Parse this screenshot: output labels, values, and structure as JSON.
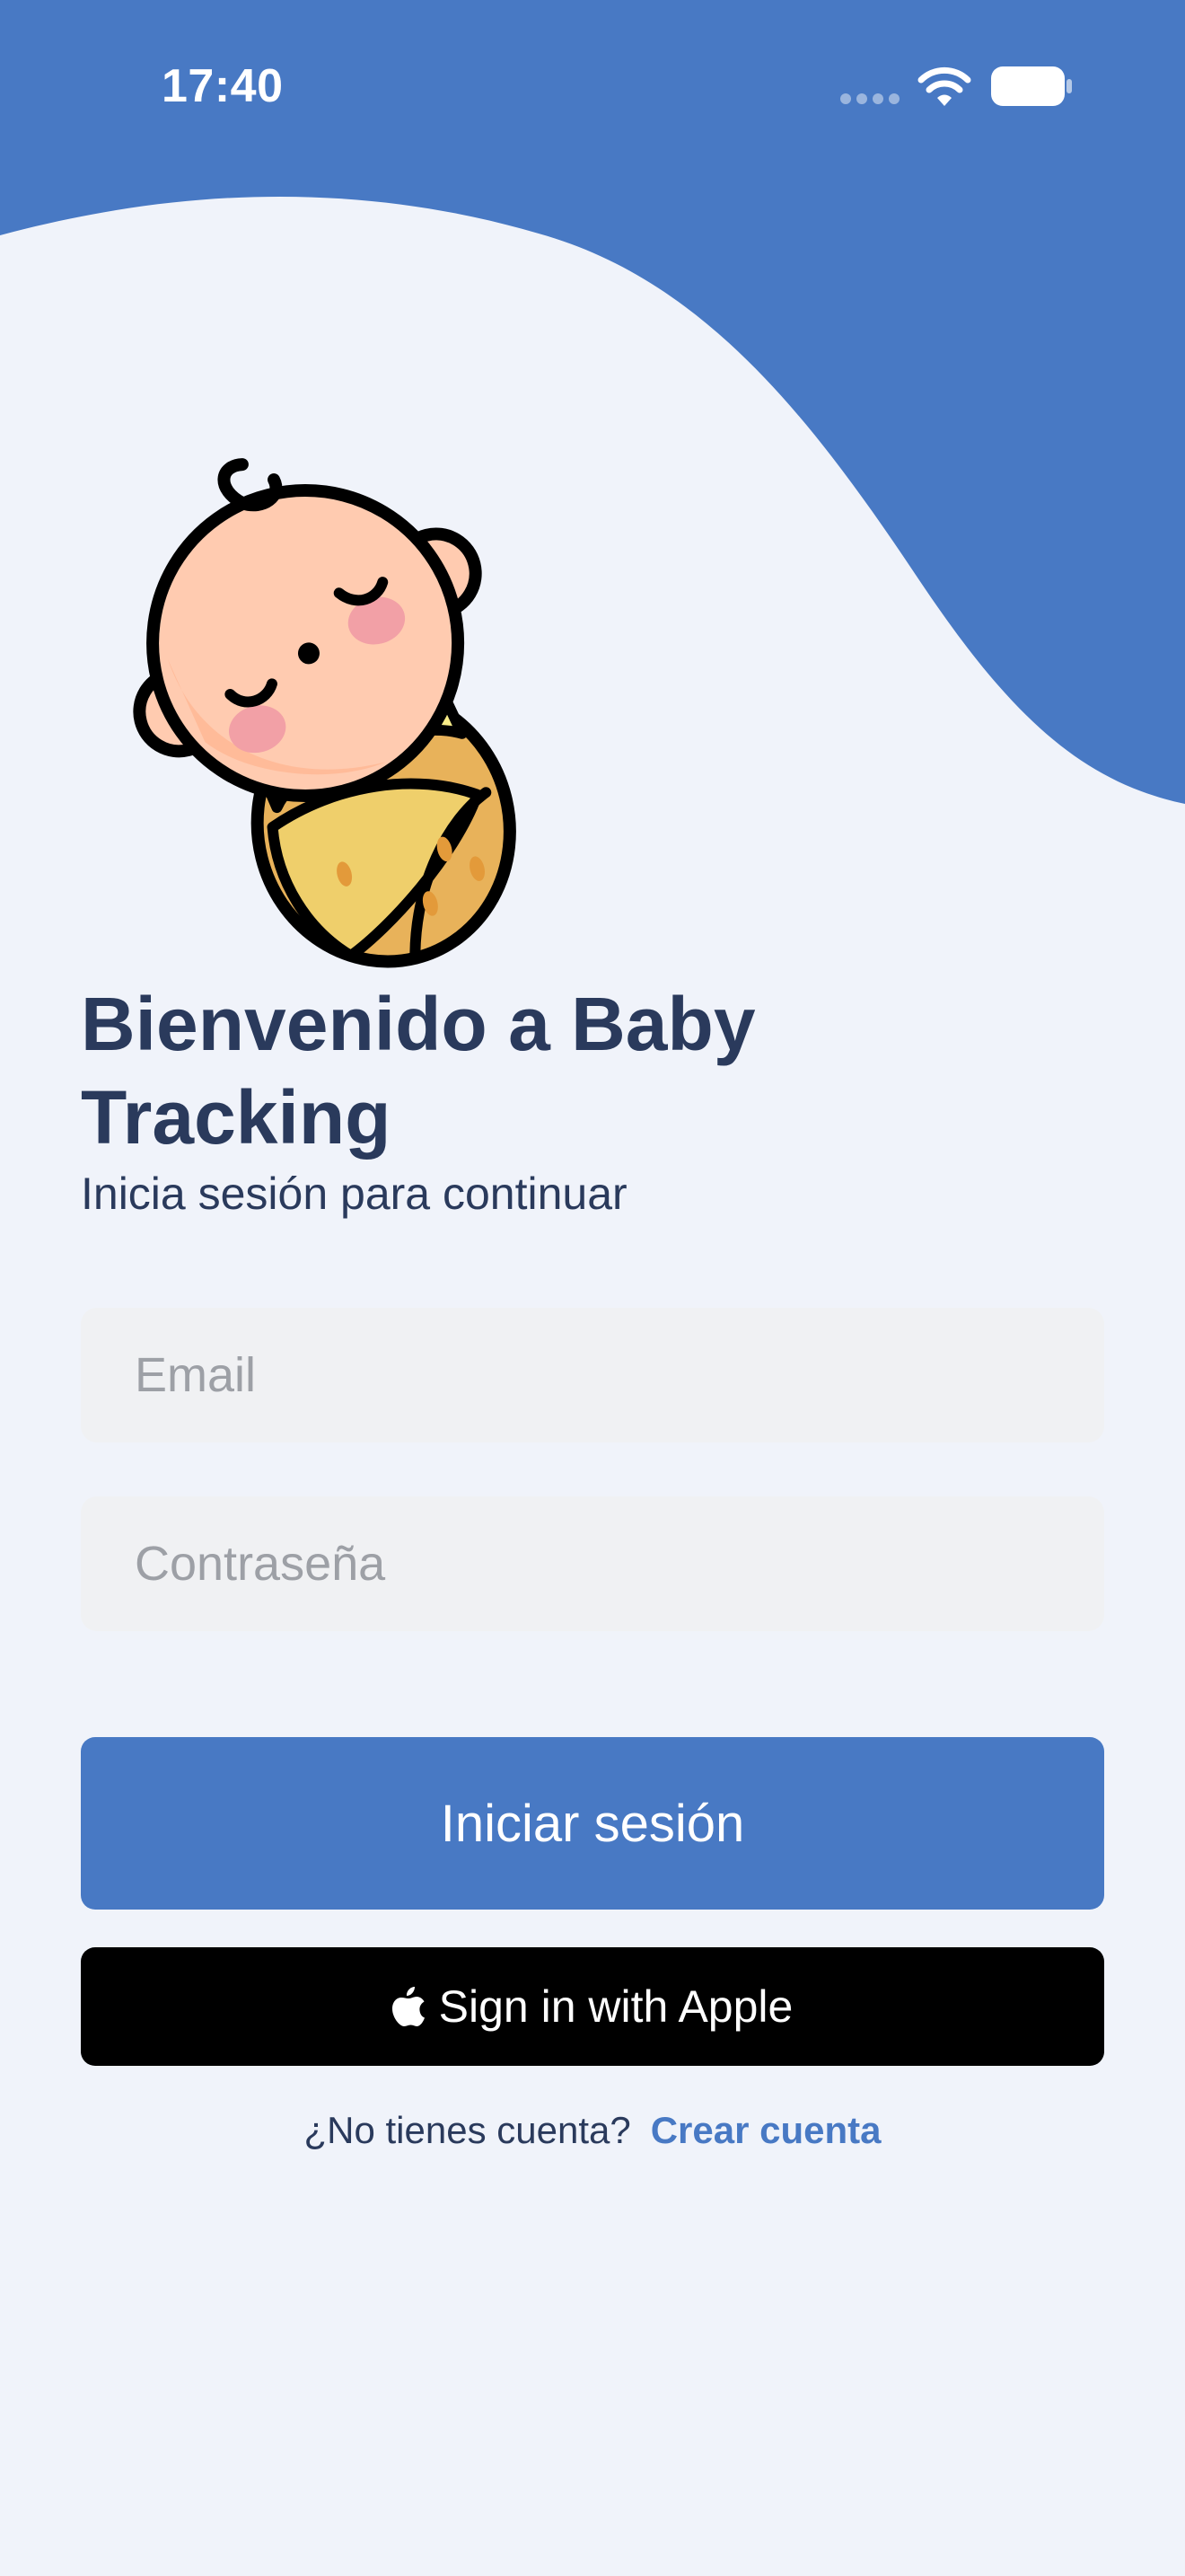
{
  "status_bar": {
    "time": "17:40"
  },
  "colors": {
    "accent": "#4879c4",
    "background": "#f0f3fa",
    "text_dark": "#2a3a5c",
    "field_bg": "#f0f1f3"
  },
  "hero": {
    "illustration": "sleeping-baby-illustration"
  },
  "login": {
    "title": "Bienvenido a Baby Tracking",
    "subtitle": "Inicia sesión para continuar",
    "email_placeholder": "Email",
    "email_value": "",
    "password_placeholder": "Contraseña",
    "password_value": "",
    "login_button": "Iniciar sesión",
    "apple_button": "Sign in with Apple",
    "apple_icon": "apple-logo-icon"
  },
  "footer": {
    "prompt": "¿No tienes cuenta?",
    "link": "Crear cuenta"
  }
}
